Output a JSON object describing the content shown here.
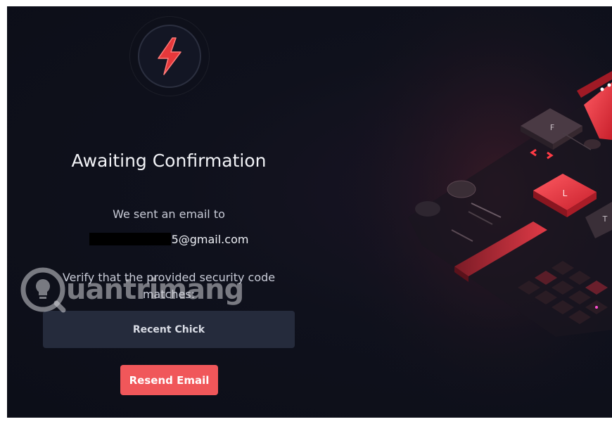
{
  "heading": {
    "title": "Awaiting Confirmation",
    "sent_label": "We sent an email to",
    "email_visible": "5@gmail.com",
    "verify_text": "Verify that the provided security code matches:"
  },
  "code": {
    "value": "Recent Chick"
  },
  "actions": {
    "resend_label": "Resend Email"
  },
  "watermark": {
    "text": "uantrimang"
  },
  "keys": {
    "f": "F",
    "l": "L",
    "t": "T"
  },
  "icons": {
    "logo": "lightning-bolt-icon",
    "watermark": "lightbulb-icon"
  },
  "colors": {
    "background": "#0f111c",
    "accent": "#f0575a",
    "code_box": "#252b3c",
    "logo_bolt": "#e5383b"
  }
}
